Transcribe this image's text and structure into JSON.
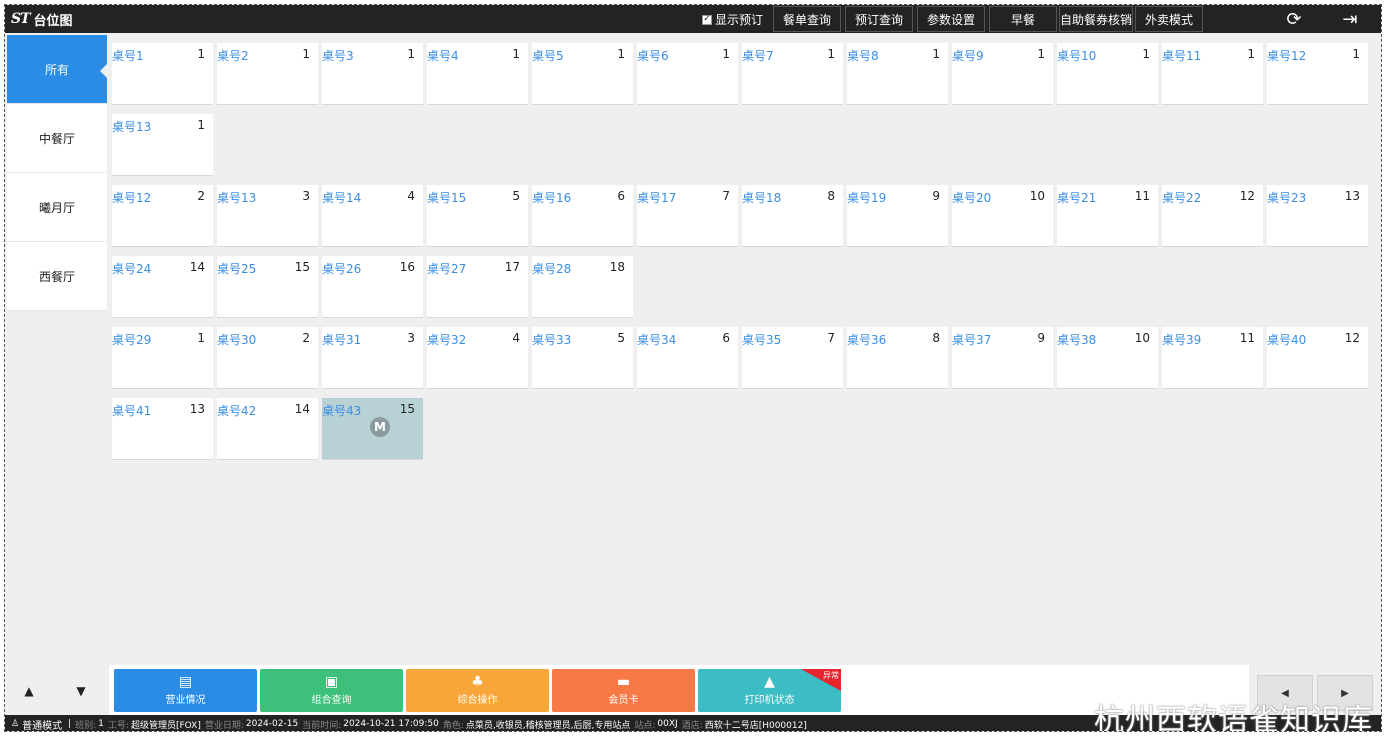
{
  "app": {
    "logo": "ST",
    "title": "台位图"
  },
  "toolbar": {
    "show_reservation_label": "显示预订",
    "show_reservation_checked": true,
    "buttons": [
      "餐单查询",
      "预订查询",
      "参数设置",
      "早餐",
      "自助餐券核销",
      "外卖模式"
    ],
    "refresh_icon": "refresh-icon",
    "logout_icon": "logout-icon"
  },
  "sidebar": {
    "items": [
      {
        "label": "所有",
        "active": true
      },
      {
        "label": "中餐厅",
        "active": false
      },
      {
        "label": "曦月厅",
        "active": false
      },
      {
        "label": "西餐厅",
        "active": false
      }
    ]
  },
  "table_rows": [
    {
      "tables": [
        {
          "name": "桌号1",
          "num": "1"
        },
        {
          "name": "桌号2",
          "num": "1"
        },
        {
          "name": "桌号3",
          "num": "1"
        },
        {
          "name": "桌号4",
          "num": "1"
        },
        {
          "name": "桌号5",
          "num": "1"
        },
        {
          "name": "桌号6",
          "num": "1"
        },
        {
          "name": "桌号7",
          "num": "1"
        },
        {
          "name": "桌号8",
          "num": "1"
        },
        {
          "name": "桌号9",
          "num": "1"
        },
        {
          "name": "桌号10",
          "num": "1"
        },
        {
          "name": "桌号11",
          "num": "1"
        },
        {
          "name": "桌号12",
          "num": "1"
        }
      ]
    },
    {
      "tables": [
        {
          "name": "桌号13",
          "num": "1"
        }
      ]
    },
    {
      "tables": [
        {
          "name": "桌号12",
          "num": "2"
        },
        {
          "name": "桌号13",
          "num": "3"
        },
        {
          "name": "桌号14",
          "num": "4"
        },
        {
          "name": "桌号15",
          "num": "5"
        },
        {
          "name": "桌号16",
          "num": "6"
        },
        {
          "name": "桌号17",
          "num": "7"
        },
        {
          "name": "桌号18",
          "num": "8"
        },
        {
          "name": "桌号19",
          "num": "9"
        },
        {
          "name": "桌号20",
          "num": "10"
        },
        {
          "name": "桌号21",
          "num": "11"
        },
        {
          "name": "桌号22",
          "num": "12"
        },
        {
          "name": "桌号23",
          "num": "13"
        }
      ]
    },
    {
      "tables": [
        {
          "name": "桌号24",
          "num": "14"
        },
        {
          "name": "桌号25",
          "num": "15"
        },
        {
          "name": "桌号26",
          "num": "16"
        },
        {
          "name": "桌号27",
          "num": "17"
        },
        {
          "name": "桌号28",
          "num": "18"
        }
      ]
    },
    {
      "tables": [
        {
          "name": "桌号29",
          "num": "1"
        },
        {
          "name": "桌号30",
          "num": "2"
        },
        {
          "name": "桌号31",
          "num": "3"
        },
        {
          "name": "桌号32",
          "num": "4"
        },
        {
          "name": "桌号33",
          "num": "5"
        },
        {
          "name": "桌号34",
          "num": "6"
        },
        {
          "name": "桌号35",
          "num": "7"
        },
        {
          "name": "桌号36",
          "num": "8"
        },
        {
          "name": "桌号37",
          "num": "9"
        },
        {
          "name": "桌号38",
          "num": "10"
        },
        {
          "name": "桌号39",
          "num": "11"
        },
        {
          "name": "桌号40",
          "num": "12"
        }
      ]
    },
    {
      "tables": [
        {
          "name": "桌号41",
          "num": "13"
        },
        {
          "name": "桌号42",
          "num": "14"
        },
        {
          "name": "桌号43",
          "num": "15",
          "occupied": true,
          "badge": "M"
        }
      ]
    }
  ],
  "nav_arrows": {
    "up": "▲",
    "down": "▼"
  },
  "actions": [
    {
      "label": "营业情况",
      "icon": "report-icon",
      "glyph": "▤",
      "color": "#2b8ce6"
    },
    {
      "label": "组合查询",
      "icon": "monitor-search-icon",
      "glyph": "▣",
      "color": "#3cc07a"
    },
    {
      "label": "综合操作",
      "icon": "user-settings-icon",
      "glyph": "♣",
      "color": "#f7a63a"
    },
    {
      "label": "会员卡",
      "icon": "card-icon",
      "glyph": "▬",
      "color": "#f77a46"
    },
    {
      "label": "打印机状态",
      "icon": "printer-icon",
      "glyph": "▲",
      "color": "#3cbcc4",
      "flag": "异常"
    }
  ],
  "pager": {
    "prev": "◀",
    "next": "▶"
  },
  "status": {
    "mode": "普通模式",
    "fields": [
      {
        "label": "班别:",
        "value": "1"
      },
      {
        "label": "工号:",
        "value": "超级管理员[FOX]"
      },
      {
        "label": "营业日期:",
        "value": "2024-02-15"
      },
      {
        "label": "当前时间:",
        "value": "2024-10-21 17:09:50"
      },
      {
        "label": "角色:",
        "value": "点菜员,收银员,稽核管理员,后厨,专用站点"
      },
      {
        "label": "站点:",
        "value": "00XJ"
      },
      {
        "label": "酒店:",
        "value": "西软十二号店[H000012]"
      }
    ]
  },
  "watermark": "杭州西软语雀知识库"
}
